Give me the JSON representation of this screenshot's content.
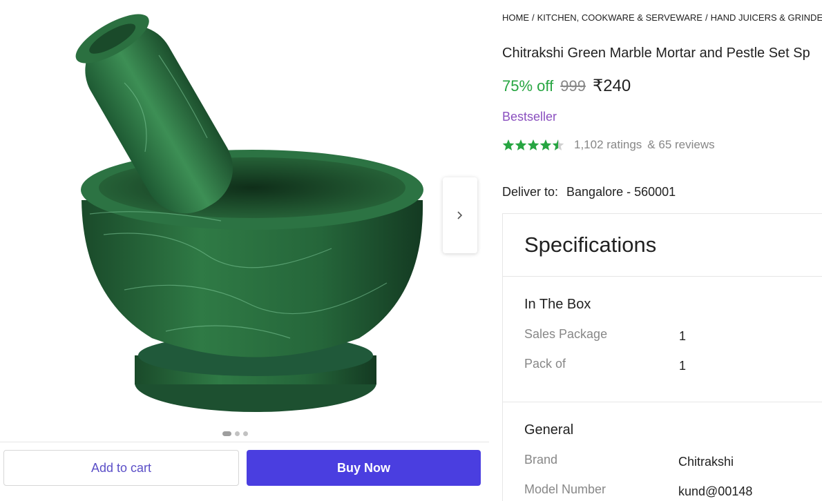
{
  "breadcrumb": [
    "HOME",
    "KITCHEN, COOKWARE & SERVEWARE",
    "HAND JUICERS & GRINDERS",
    ""
  ],
  "product": {
    "title": "Chitrakshi Green Marble Mortar and Pestle Set Sp",
    "discount": "75% off",
    "mrp": "999",
    "price": "₹240",
    "badge": "Bestseller",
    "rating_value": 4.5,
    "ratings_text": "1,102 ratings",
    "reviews_text": "& 65 reviews",
    "image_icon": "mortar-pestle-image"
  },
  "delivery": {
    "label": "Deliver to:",
    "location": "Bangalore - 560001"
  },
  "gallery": {
    "dots": 3,
    "active_dot": 0
  },
  "actions": {
    "add_to_cart": "Add to cart",
    "buy_now": "Buy Now"
  },
  "specifications": {
    "title": "Specifications",
    "groups": [
      {
        "name": "In The Box",
        "rows": [
          {
            "key": "Sales Package",
            "value": "1"
          },
          {
            "key": "Pack of",
            "value": "1"
          }
        ]
      },
      {
        "name": "General",
        "rows": [
          {
            "key": "Brand",
            "value": "Chitrakshi"
          },
          {
            "key": "Model Number",
            "value": "kund@00148"
          }
        ]
      }
    ]
  },
  "colors": {
    "discount": "#26a541",
    "star": "#26a541",
    "badge": "#8a4fbf",
    "buy_button": "#4a3ee0",
    "cart_text": "#5b4fc7"
  }
}
